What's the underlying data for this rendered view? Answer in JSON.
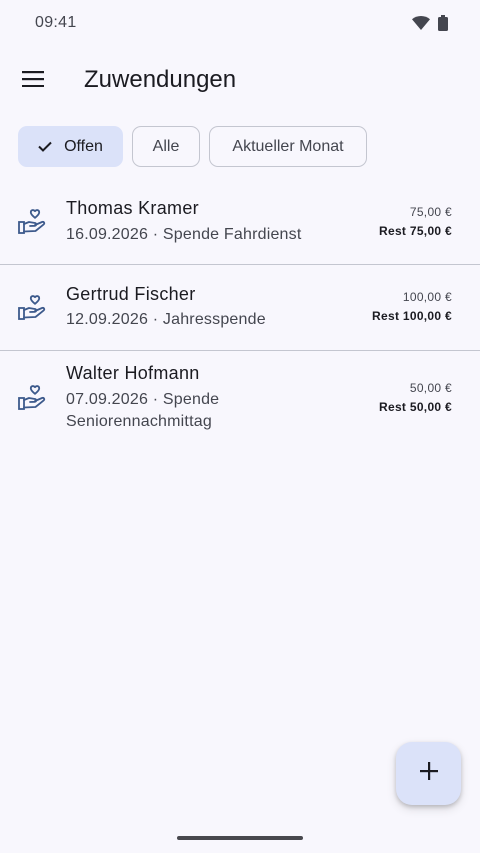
{
  "status_bar": {
    "time": "09:41",
    "icons": [
      "wifi-icon",
      "battery-icon"
    ]
  },
  "app_bar": {
    "menu_icon": "menu-icon",
    "title": "Zuwendungen"
  },
  "filters": [
    {
      "label": "Offen",
      "selected": true
    },
    {
      "label": "Alle",
      "selected": false
    },
    {
      "label": "Aktueller Monat",
      "selected": false
    }
  ],
  "donations": [
    {
      "icon": "hand-heart-icon",
      "name": "Thomas Kramer",
      "subtitle": "16.09.2026 · Spende Fahrdienst",
      "amount": "75,00 €",
      "rest": "Rest 75,00 €"
    },
    {
      "icon": "hand-heart-icon",
      "name": "Gertrud Fischer",
      "subtitle": "12.09.2026 · Jahresspende",
      "amount": "100,00 €",
      "rest": "Rest 100,00 €"
    },
    {
      "icon": "hand-heart-icon",
      "name": "Walter Hofmann",
      "subtitle": "07.09.2026 · Spende Seniorennachmittag",
      "amount": "50,00 €",
      "rest": "Rest 50,00 €"
    }
  ],
  "fab": {
    "icon": "add-icon"
  },
  "colors": {
    "background": "#f8f7fd",
    "chip_selected": "#dbe2f9",
    "icon_primary": "#3d5a8c",
    "divider": "#c4c6d0"
  }
}
